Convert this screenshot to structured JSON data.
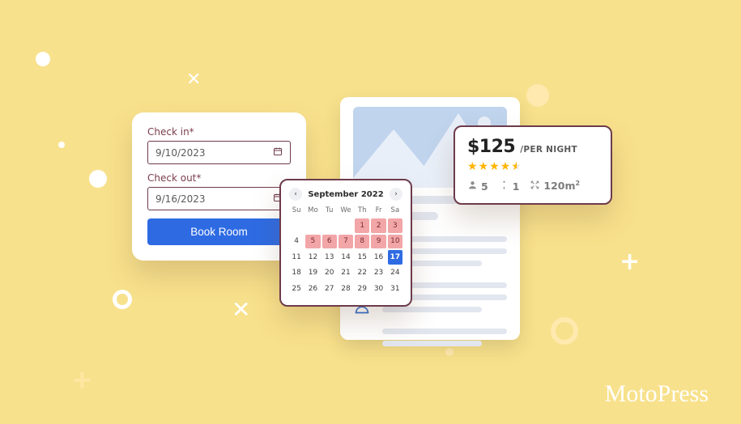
{
  "booking": {
    "check_in_label": "Check in*",
    "check_in_value": "9/10/2023",
    "check_out_label": "Check out*",
    "check_out_value": "9/16/2023",
    "button_label": "Book Room"
  },
  "calendar": {
    "title": "September 2022",
    "dow": [
      "Su",
      "Mo",
      "Tu",
      "We",
      "Th",
      "Fr",
      "Sa"
    ],
    "cells": [
      {
        "n": "",
        "cls": "blank"
      },
      {
        "n": "",
        "cls": "blank"
      },
      {
        "n": "",
        "cls": "blank"
      },
      {
        "n": "",
        "cls": "blank"
      },
      {
        "n": "1",
        "cls": "r"
      },
      {
        "n": "2",
        "cls": "r"
      },
      {
        "n": "3",
        "cls": "r"
      },
      {
        "n": "4",
        "cls": ""
      },
      {
        "n": "5",
        "cls": "r"
      },
      {
        "n": "6",
        "cls": "r"
      },
      {
        "n": "7",
        "cls": "r"
      },
      {
        "n": "8",
        "cls": "r"
      },
      {
        "n": "9",
        "cls": "r"
      },
      {
        "n": "10",
        "cls": "r"
      },
      {
        "n": "11",
        "cls": ""
      },
      {
        "n": "12",
        "cls": ""
      },
      {
        "n": "13",
        "cls": ""
      },
      {
        "n": "14",
        "cls": ""
      },
      {
        "n": "15",
        "cls": ""
      },
      {
        "n": "16",
        "cls": ""
      },
      {
        "n": "17",
        "cls": "b"
      },
      {
        "n": "18",
        "cls": ""
      },
      {
        "n": "19",
        "cls": ""
      },
      {
        "n": "20",
        "cls": ""
      },
      {
        "n": "21",
        "cls": ""
      },
      {
        "n": "22",
        "cls": ""
      },
      {
        "n": "23",
        "cls": ""
      },
      {
        "n": "24",
        "cls": ""
      },
      {
        "n": "25",
        "cls": ""
      },
      {
        "n": "26",
        "cls": ""
      },
      {
        "n": "27",
        "cls": ""
      },
      {
        "n": "28",
        "cls": ""
      },
      {
        "n": "29",
        "cls": ""
      },
      {
        "n": "30",
        "cls": ""
      },
      {
        "n": "31",
        "cls": ""
      }
    ]
  },
  "price": {
    "amount": "$125",
    "per": "/PER NIGHT",
    "rating_stars": "★★★★⯨",
    "guests": "5",
    "beds": "1",
    "area": "120",
    "area_unit": "m"
  },
  "amenities": [
    "tv-icon",
    "dining-icon",
    "concierge-bell-icon"
  ],
  "brand": "MotoPress"
}
